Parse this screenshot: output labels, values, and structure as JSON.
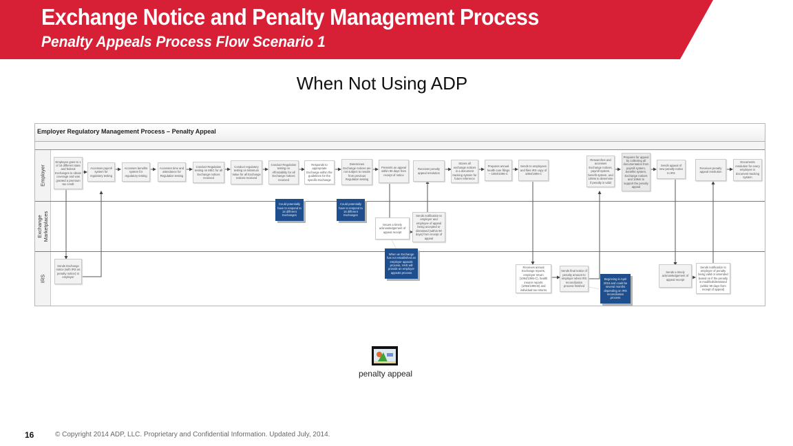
{
  "header": {
    "title": "Exchange Notice and Penalty Management Process",
    "subtitle": "Penalty Appeals Process Flow Scenario 1",
    "brand_color": "#d71f35"
  },
  "heading": "When Not Using ADP",
  "diagram": {
    "title": "Employer Regulatory Management Process – Penalty Appeal",
    "lanes": [
      {
        "label": "Employer"
      },
      {
        "label": "Exchange Marketplaces"
      },
      {
        "label": "IRS"
      }
    ],
    "steps": {
      "e1": "Employee goes to 1 of 16 different state and federal Exchanges to obtain coverage and was granted a premium tax credit",
      "e2": "Accesses payroll system for regulatory testing",
      "e3": "Accesses benefits system for regulatory testing",
      "e4": "Accesses time and attendance for Regulation testing",
      "e5": "Conduct Regulation testing on MEC for all Exchange notices received",
      "e6": "Conduct regulatory testing on Minimum Value for all Exchange notices received",
      "e7": "Conduct Regulation testing on Affordability for all Exchange notices received",
      "e8": "Responds to appropriate Exchange within the guidelines for the specific Exchange",
      "e9": "Determines Exchange notices are not subject to results from previous Regulation testing",
      "e10": "Presents an appeal within 90 days from receipt of notice",
      "e11": "Receives penalty appeal resolution",
      "e12": "Stores all exchange notices in a document tracking system for future reference",
      "e13": "Prepares annual health care filings – 1094/1095-C",
      "e14": "Sends to employees and files IRS copy of 1094/1095-C",
      "e15": "Researches and accesses Exchange notices, payroll system, benefit system, and 1094s to determine if penalty is valid",
      "e16": "Prepares for appeal by collecting all documentation from payroll system, benefits system, Exchange notices and 1094s to support the penalty appeal",
      "e17": "Sends appeal of new penalty notice to IRS",
      "e18": "Receives penalty appeal resolution",
      "e19": "Documents resolution for every employee in document tracking system",
      "x1": "Issues a timely acknowledgement of appeal receipt",
      "x2": "Sends notification to employer and employee of appeal being accepted or dismissed (within 90 days) from receipt of appeal",
      "i1": "Sends Exchange notice (with IRS as penalty notice) to employer",
      "i2": "Receives annual Exchange reports, employer return (1094/1095-C), health insurer reports (1094/1095-B) and individual tax returns",
      "i3": "Sends final notice of penalty amount to employer when IRS reconciliation process finished",
      "i4": "Sends a timely acknowledgement of appeal receipt",
      "i5": "Sends notification to employer of penalty being valid or amended based on if the penalty is modified/dismissed (within 90 days from receipt of appeal)"
    },
    "notes": {
      "n1": "Could potentially have to respond to 16 different Exchanges",
      "n2": "Could potentially have to respond to 16 different Exchanges",
      "n3": "When an Exchange has not established an employer appeals process, HHS will provide an employer appeals process",
      "n4": "Beginning in April 2016 and could be several months depending on IRS reconciliation process"
    }
  },
  "attachment": {
    "icon": "image-file-icon",
    "label": "penalty appeal"
  },
  "footer": {
    "page_number": "16",
    "copyright": "© Copyright 2014 ADP, LLC. Proprietary and Confidential Information. Updated July, 2014."
  }
}
